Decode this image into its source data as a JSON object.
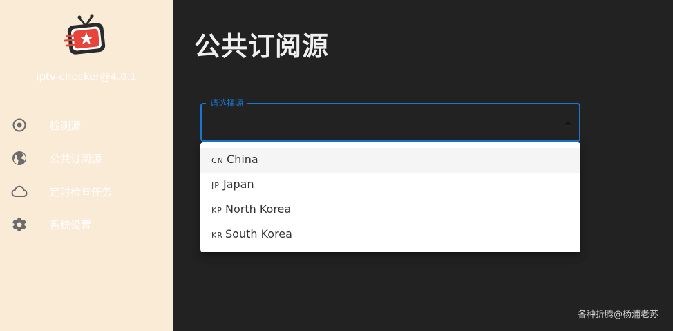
{
  "sidebar": {
    "app_name": "iptv-checker@4.0.1",
    "items": [
      {
        "label": "检测源",
        "icon": "radio-button-icon"
      },
      {
        "label": "公共订阅源",
        "icon": "globe-icon"
      },
      {
        "label": "定时检查任务",
        "icon": "cloud-icon"
      },
      {
        "label": "系统设置",
        "icon": "gear-icon"
      }
    ]
  },
  "main": {
    "title": "公共订阅源",
    "select": {
      "label": "请选择源",
      "value": "",
      "options": [
        {
          "code": "CN",
          "name": "China"
        },
        {
          "code": "JP",
          "name": "Japan"
        },
        {
          "code": "KP",
          "name": "North Korea"
        },
        {
          "code": "KR",
          "name": "South Korea"
        }
      ]
    }
  },
  "watermark": "各种折腾@杨浦老苏",
  "colors": {
    "sidebar_bg": "#faebd7",
    "main_bg": "#222222",
    "accent": "#1976d2",
    "logo_red": "#e8443a",
    "logo_dark": "#2b2b2b"
  }
}
